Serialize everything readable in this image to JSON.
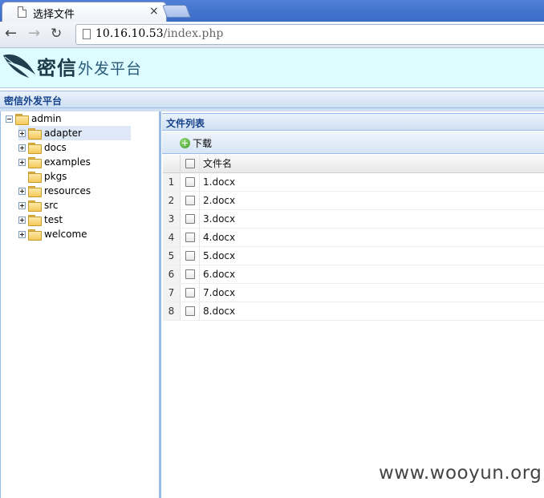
{
  "browser": {
    "tab_title": "选择文件",
    "tab_close": "×",
    "url_host": "10.16.10.53",
    "url_path": "/index.php",
    "back": "←",
    "forward": "→",
    "reload": "↻"
  },
  "header": {
    "logo_main": "密信",
    "logo_sub": "外发平台"
  },
  "app_title": "密信外发平台",
  "tree": {
    "root": "admin",
    "children": [
      {
        "label": "adapter",
        "expandable": true,
        "selected": true
      },
      {
        "label": "docs",
        "expandable": true
      },
      {
        "label": "examples",
        "expandable": true
      },
      {
        "label": "pkgs",
        "expandable": false
      },
      {
        "label": "resources",
        "expandable": true
      },
      {
        "label": "src",
        "expandable": true
      },
      {
        "label": "test",
        "expandable": true
      },
      {
        "label": "welcome",
        "expandable": true
      }
    ]
  },
  "file_list": {
    "title": "文件列表",
    "download_label": "下载",
    "column_name": "文件名",
    "rows": [
      {
        "num": "1",
        "name": "1.docx"
      },
      {
        "num": "2",
        "name": "2.docx"
      },
      {
        "num": "3",
        "name": "3.docx"
      },
      {
        "num": "4",
        "name": "4.docx"
      },
      {
        "num": "5",
        "name": "5.docx"
      },
      {
        "num": "6",
        "name": "6.docx"
      },
      {
        "num": "7",
        "name": "7.docx"
      },
      {
        "num": "8",
        "name": "8.docx"
      }
    ]
  },
  "watermark": "www.wooyun.org"
}
